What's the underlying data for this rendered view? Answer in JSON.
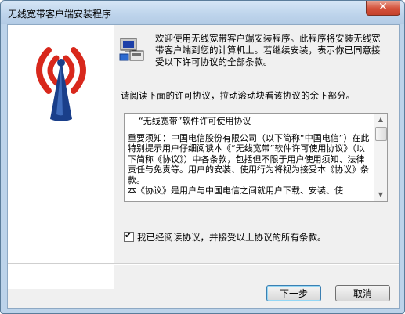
{
  "window": {
    "title": "无线宽带客户端安装程序"
  },
  "welcome": "欢迎使用无线宽带客户端安装程序。此程序将安装无线宽带客户端到您的计算机上。若继续安装，表示你已同意接受以下许可协议的全部条款。",
  "instruction": "请阅读下面的许可协议，拉动滚动块看该协议的余下部分。",
  "license": {
    "title": "“无线宽带”软件许可使用协议",
    "body1": "重要须知：中国电信股份有限公司（以下简称“中国电信”）在此特别提示用户仔细阅读本《“无线宽带”软件许可使用协议》（以下简称《协议》）中各条款，包括但不限于用户使用须知、法律责任与免责等。用户的安装、使用行为将视为接受本《协议》条款。",
    "body2": "本《协议》是用户与中国电信之间就用户下载、安装、使"
  },
  "agree": {
    "label": "我已经阅读协议，并接受以上协议的所有条款。",
    "checked": true
  },
  "buttons": {
    "next": "下一步",
    "cancel": "取消"
  },
  "icons": {
    "close": "close-icon",
    "wifi_logo": "wireless-tower-logo",
    "installer": "computer-install-icon"
  },
  "colors": {
    "accent": "#3c7fb1",
    "logo_red": "#d8281c",
    "logo_blue": "#1a3f8a"
  }
}
